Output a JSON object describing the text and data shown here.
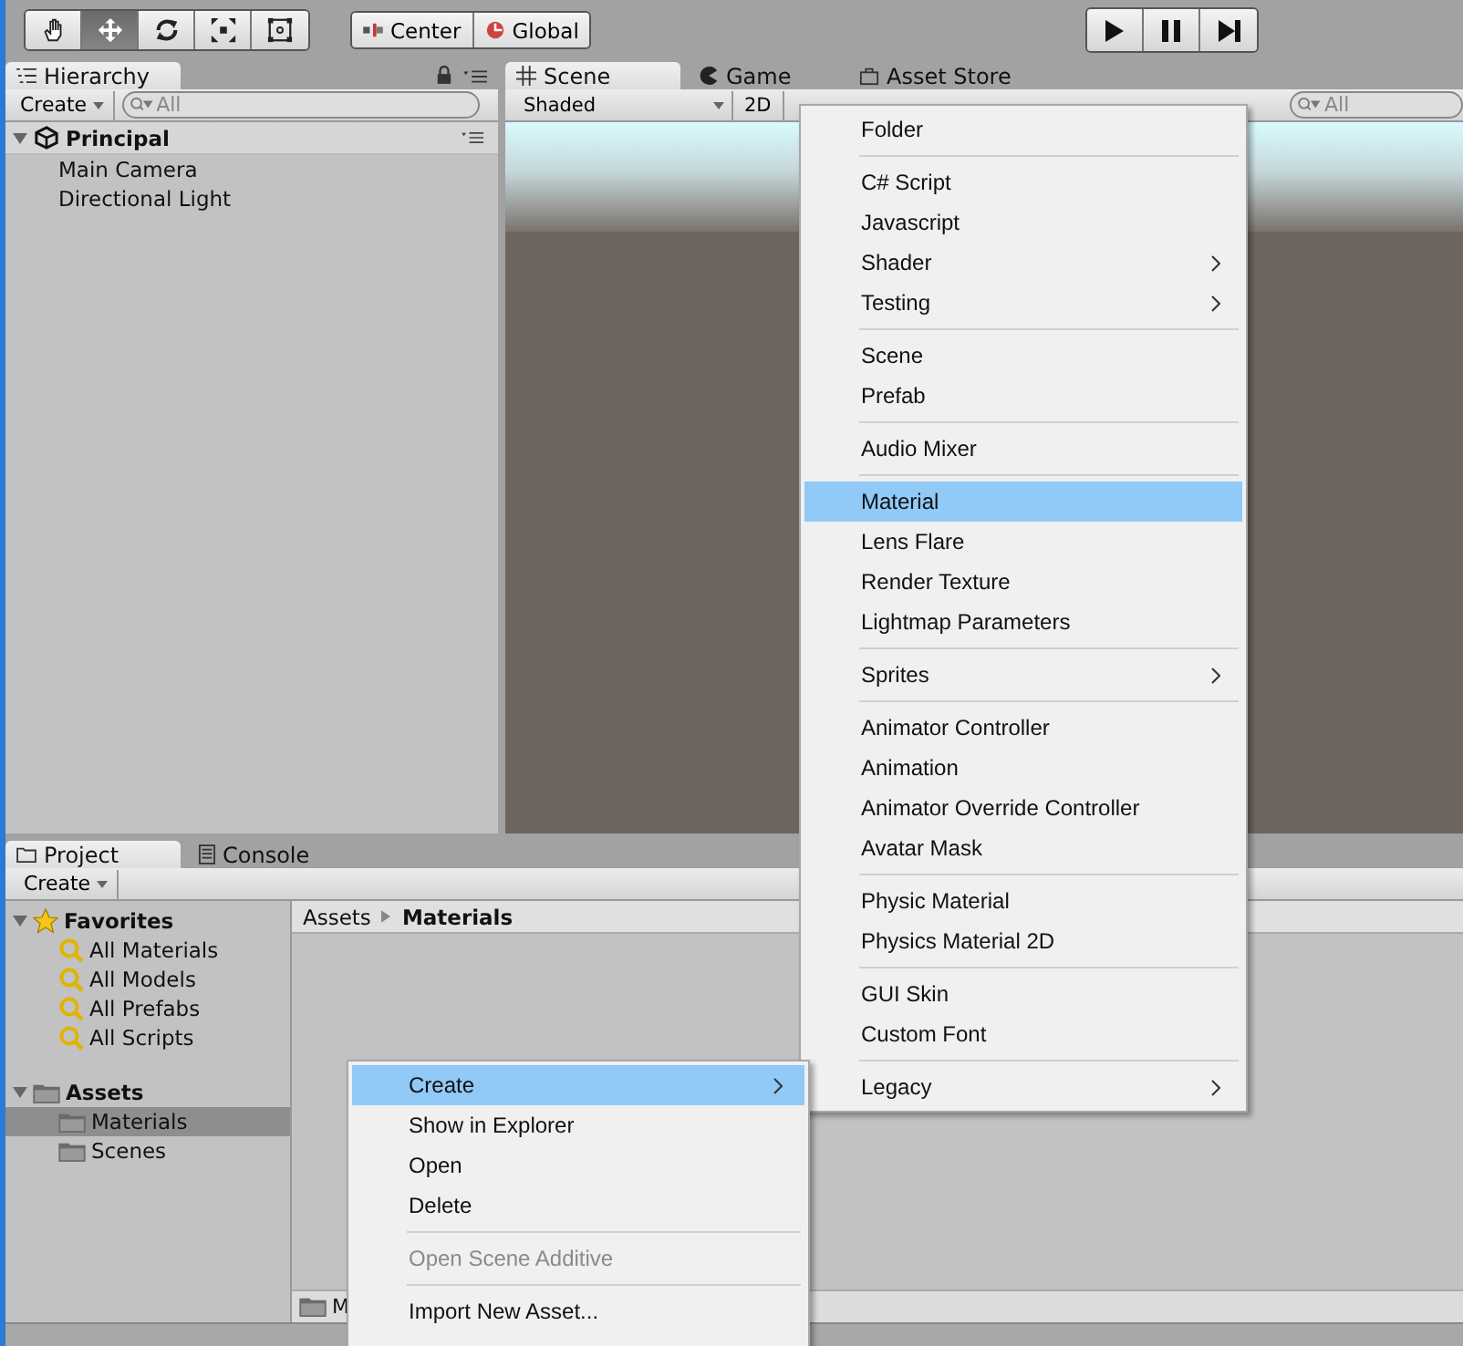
{
  "toolbar": {
    "tools": [
      {
        "kind": "hand",
        "selected": false
      },
      {
        "kind": "move",
        "selected": true
      },
      {
        "kind": "rotate",
        "selected": false
      },
      {
        "kind": "scale",
        "selected": false
      },
      {
        "kind": "rect",
        "selected": false
      }
    ],
    "pivot": [
      {
        "kind": "pivot",
        "label": "Center"
      },
      {
        "kind": "global",
        "label": "Global"
      }
    ],
    "playback": [
      {
        "kind": "play"
      },
      {
        "kind": "pause"
      },
      {
        "kind": "step"
      }
    ]
  },
  "hierarchy": {
    "tab": "Hierarchy",
    "create": "Create",
    "search_placeholder": "All",
    "scene": {
      "name": "Principal",
      "expanded": true,
      "children": [
        {
          "name": "Main Camera"
        },
        {
          "name": "Directional Light"
        }
      ]
    }
  },
  "scene_tabs": [
    {
      "kind": "scene",
      "label": "Scene",
      "selected": true
    },
    {
      "kind": "game",
      "label": "Game",
      "selected": false
    },
    {
      "kind": "store",
      "label": "Asset Store",
      "selected": false
    }
  ],
  "scene_toolbar": {
    "shading": "Shaded",
    "mode": "2D",
    "search_placeholder": "All"
  },
  "project": {
    "tabs": [
      {
        "kind": "project",
        "label": "Project",
        "selected": true
      },
      {
        "kind": "console",
        "label": "Console",
        "selected": false
      }
    ],
    "create": "Create",
    "tree": [
      {
        "kind": "favorites",
        "label": "Favorites",
        "expanded": true,
        "children": [
          {
            "label": "All Materials",
            "selected": false
          },
          {
            "label": "All Models",
            "selected": false
          },
          {
            "label": "All Prefabs",
            "selected": false
          },
          {
            "label": "All Scripts",
            "selected": false
          }
        ]
      },
      {
        "kind": "folder",
        "label": "Assets",
        "expanded": true,
        "children": [
          {
            "label": "Materials",
            "selected": true
          },
          {
            "label": "Scenes",
            "selected": false
          }
        ]
      }
    ],
    "breadcrumb": [
      "Assets",
      "Materials"
    ],
    "footer_path": "M"
  },
  "context_menu": [
    {
      "kind": "item",
      "label": "Create",
      "submenu": true,
      "selected": true,
      "disabled": false
    },
    {
      "kind": "item",
      "label": "Show in Explorer",
      "submenu": false,
      "selected": false,
      "disabled": false
    },
    {
      "kind": "item",
      "label": "Open",
      "submenu": false,
      "selected": false,
      "disabled": false
    },
    {
      "kind": "item",
      "label": "Delete",
      "submenu": false,
      "selected": false,
      "disabled": false
    },
    {
      "kind": "separator"
    },
    {
      "kind": "item",
      "label": "Open Scene Additive",
      "submenu": false,
      "selected": false,
      "disabled": true
    },
    {
      "kind": "separator"
    },
    {
      "kind": "item",
      "label": "Import New Asset...",
      "submenu": false,
      "selected": false,
      "disabled": false
    }
  ],
  "create_submenu": [
    {
      "kind": "item",
      "label": "Folder",
      "submenu": false,
      "selected": false
    },
    {
      "kind": "separator"
    },
    {
      "kind": "item",
      "label": "C# Script",
      "submenu": false,
      "selected": false
    },
    {
      "kind": "item",
      "label": "Javascript",
      "submenu": false,
      "selected": false
    },
    {
      "kind": "item",
      "label": "Shader",
      "submenu": true,
      "selected": false
    },
    {
      "kind": "item",
      "label": "Testing",
      "submenu": true,
      "selected": false
    },
    {
      "kind": "separator"
    },
    {
      "kind": "item",
      "label": "Scene",
      "submenu": false,
      "selected": false
    },
    {
      "kind": "item",
      "label": "Prefab",
      "submenu": false,
      "selected": false
    },
    {
      "kind": "separator"
    },
    {
      "kind": "item",
      "label": "Audio Mixer",
      "submenu": false,
      "selected": false
    },
    {
      "kind": "separator"
    },
    {
      "kind": "item",
      "label": "Material",
      "submenu": false,
      "selected": true
    },
    {
      "kind": "item",
      "label": "Lens Flare",
      "submenu": false,
      "selected": false
    },
    {
      "kind": "item",
      "label": "Render Texture",
      "submenu": false,
      "selected": false
    },
    {
      "kind": "item",
      "label": "Lightmap Parameters",
      "submenu": false,
      "selected": false
    },
    {
      "kind": "separator"
    },
    {
      "kind": "item",
      "label": "Sprites",
      "submenu": true,
      "selected": false
    },
    {
      "kind": "separator"
    },
    {
      "kind": "item",
      "label": "Animator Controller",
      "submenu": false,
      "selected": false
    },
    {
      "kind": "item",
      "label": "Animation",
      "submenu": false,
      "selected": false
    },
    {
      "kind": "item",
      "label": "Animator Override Controller",
      "submenu": false,
      "selected": false
    },
    {
      "kind": "item",
      "label": "Avatar Mask",
      "submenu": false,
      "selected": false
    },
    {
      "kind": "separator"
    },
    {
      "kind": "item",
      "label": "Physic Material",
      "submenu": false,
      "selected": false
    },
    {
      "kind": "item",
      "label": "Physics Material 2D",
      "submenu": false,
      "selected": false
    },
    {
      "kind": "separator"
    },
    {
      "kind": "item",
      "label": "GUI Skin",
      "submenu": false,
      "selected": false
    },
    {
      "kind": "item",
      "label": "Custom Font",
      "submenu": false,
      "selected": false
    },
    {
      "kind": "separator"
    },
    {
      "kind": "item",
      "label": "Legacy",
      "submenu": true,
      "selected": false
    }
  ]
}
